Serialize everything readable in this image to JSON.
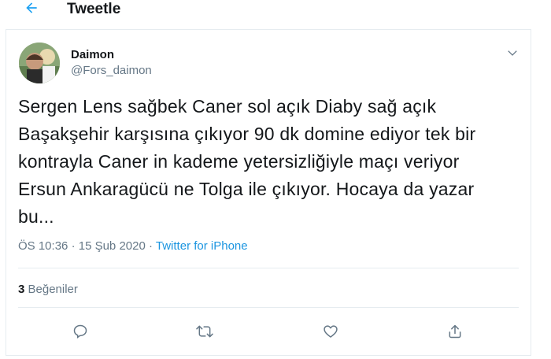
{
  "header": {
    "back_icon": "back-arrow-icon",
    "title": "Tweetle"
  },
  "tweet": {
    "author_name": "Daimon",
    "author_handle": "@Fors_daimon",
    "text": "Sergen Lens sağbek Caner sol açık Diaby sağ açık\nBaşakşehir karşısına çıkıyor 90 dk domine ediyor tek bir\nkontrayla Caner in kademe yetersizliğiyle maçı veriyor\nErsun Ankaragücü ne Tolga ile çıkıyor. Hocaya da yazar\nbu...",
    "time": "ÖS 10:36",
    "date": "15 Şub 2020",
    "separator": "·",
    "source": "Twitter for iPhone",
    "likes_count": "3",
    "likes_label": "Beğeniler"
  },
  "actions": [
    {
      "icon": "reply-icon"
    },
    {
      "icon": "retweet-icon"
    },
    {
      "icon": "like-heart-icon"
    },
    {
      "icon": "share-icon"
    }
  ],
  "colors": {
    "accent": "#1da1f2",
    "link": "#1b95e0",
    "secondary_text": "#657786",
    "border": "#e6ecf0",
    "primary_text": "#14171a"
  }
}
